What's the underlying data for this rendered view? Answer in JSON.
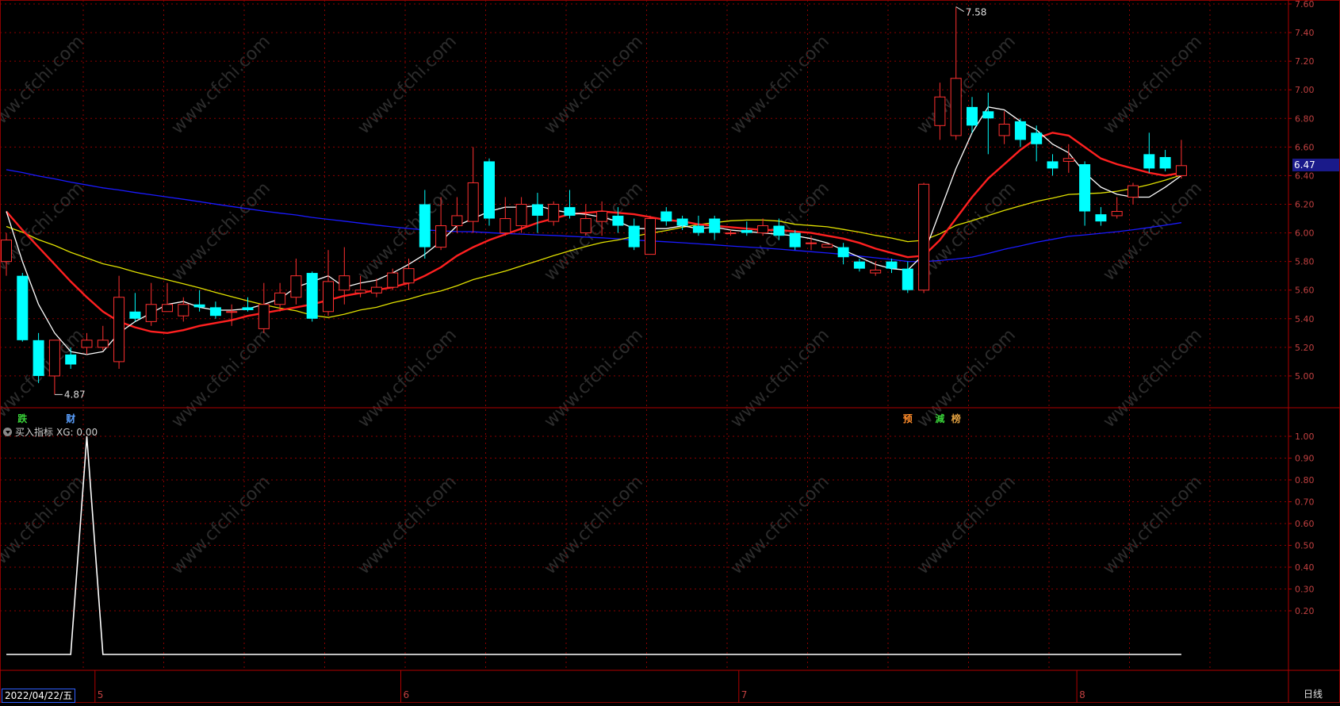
{
  "indicator": {
    "title": "买入指标",
    "value_label": "XG: 0.00"
  },
  "cursor_date": "2022/04/22/五",
  "period_button": "日线",
  "last_price_tag": "6.47",
  "markers": {
    "low_label": "4.87",
    "high_label": "7.58"
  },
  "event_tags": [
    {
      "text": "跌",
      "color": "#39d239",
      "bar": 1
    },
    {
      "text": "财",
      "color": "#5aa0ff",
      "bar": 4
    },
    {
      "text": "预",
      "color": "#ff8c2a",
      "bar": 56
    },
    {
      "text": "減",
      "color": "#39d239",
      "bar": 58
    },
    {
      "text": "榜",
      "color": "#e0a040",
      "bar": 59
    }
  ],
  "watermark": "www.cfchi.com",
  "colors": {
    "up": "#ff3030",
    "down": "#00ffff",
    "ma5": "#ffffff",
    "ma10": "#ff2020",
    "ma20": "#e0e000",
    "ma60": "#1a1aff",
    "grid": "#8b0000"
  },
  "chart_data": [
    {
      "type": "candlestick",
      "ylim": [
        4.8,
        7.6
      ],
      "y_ticks": [
        "7.60",
        "7.40",
        "7.20",
        "7.00",
        "6.80",
        "6.60",
        "6.40",
        "6.20",
        "6.00",
        "5.80",
        "5.60",
        "5.40",
        "5.20",
        "5.00"
      ],
      "x_month_labels": [
        {
          "label": "5",
          "bar": 6
        },
        {
          "label": "6",
          "bar": 25
        },
        {
          "label": "7",
          "bar": 46
        },
        {
          "label": "8",
          "bar": 67
        }
      ],
      "candles": [
        [
          5.8,
          5.95,
          6.0,
          5.7
        ],
        [
          5.7,
          5.25,
          5.72,
          5.24
        ],
        [
          5.25,
          5.0,
          5.3,
          4.95
        ],
        [
          5.0,
          5.25,
          5.25,
          4.87
        ],
        [
          5.15,
          5.08,
          5.2,
          5.05
        ],
        [
          5.2,
          5.25,
          5.3,
          5.15
        ],
        [
          5.2,
          5.25,
          5.35,
          5.18
        ],
        [
          5.1,
          5.55,
          5.7,
          5.05
        ],
        [
          5.45,
          5.4,
          5.58,
          5.38
        ],
        [
          5.38,
          5.5,
          5.65,
          5.35
        ],
        [
          5.45,
          5.5,
          5.65,
          5.45
        ],
        [
          5.42,
          5.5,
          5.55,
          5.38
        ],
        [
          5.5,
          5.48,
          5.6,
          5.45
        ],
        [
          5.48,
          5.42,
          5.52,
          5.4
        ],
        [
          5.45,
          5.45,
          5.5,
          5.35
        ],
        [
          5.48,
          5.46,
          5.55,
          5.45
        ],
        [
          5.33,
          5.5,
          5.65,
          5.3
        ],
        [
          5.5,
          5.58,
          5.65,
          5.45
        ],
        [
          5.55,
          5.7,
          5.82,
          5.5
        ],
        [
          5.72,
          5.4,
          5.73,
          5.38
        ],
        [
          5.45,
          5.66,
          5.88,
          5.42
        ],
        [
          5.6,
          5.7,
          5.9,
          5.5
        ],
        [
          5.58,
          5.6,
          5.7,
          5.55
        ],
        [
          5.58,
          5.62,
          5.68,
          5.55
        ],
        [
          5.62,
          5.72,
          5.75,
          5.6
        ],
        [
          5.65,
          5.75,
          5.82,
          5.6
        ],
        [
          6.2,
          5.9,
          6.3,
          5.82
        ],
        [
          5.9,
          6.05,
          6.25,
          5.88
        ],
        [
          6.05,
          6.12,
          6.25,
          6.0
        ],
        [
          6.08,
          6.35,
          6.6,
          6.0
        ],
        [
          6.5,
          6.1,
          6.52,
          6.05
        ],
        [
          6.0,
          6.1,
          6.25,
          5.98
        ],
        [
          6.05,
          6.2,
          6.25,
          6.0
        ],
        [
          6.2,
          6.12,
          6.28,
          6.0
        ],
        [
          6.08,
          6.2,
          6.22,
          6.05
        ],
        [
          6.18,
          6.12,
          6.3,
          6.1
        ],
        [
          6.0,
          6.1,
          6.2,
          5.98
        ],
        [
          6.08,
          6.15,
          6.22,
          5.98
        ],
        [
          6.12,
          6.05,
          6.18,
          6.0
        ],
        [
          6.05,
          5.9,
          6.1,
          5.88
        ],
        [
          5.85,
          6.1,
          6.12,
          5.85
        ],
        [
          6.15,
          6.08,
          6.18,
          6.05
        ],
        [
          6.1,
          6.05,
          6.12,
          6.02
        ],
        [
          6.05,
          6.0,
          6.12,
          5.98
        ],
        [
          6.1,
          6.0,
          6.12,
          5.95
        ],
        [
          6.0,
          6.0,
          6.02,
          5.98
        ],
        [
          6.02,
          6.0,
          6.08,
          5.98
        ],
        [
          6.0,
          6.05,
          6.1,
          5.98
        ],
        [
          6.05,
          5.98,
          6.1,
          5.95
        ],
        [
          6.0,
          5.9,
          6.02,
          5.88
        ],
        [
          5.93,
          5.93,
          5.98,
          5.88
        ],
        [
          5.9,
          5.92,
          5.92,
          5.9
        ],
        [
          5.9,
          5.83,
          5.93,
          5.78
        ],
        [
          5.8,
          5.75,
          5.82,
          5.73
        ],
        [
          5.72,
          5.74,
          5.8,
          5.7
        ],
        [
          5.8,
          5.75,
          5.82,
          5.72
        ],
        [
          5.75,
          5.6,
          5.8,
          5.58
        ],
        [
          5.6,
          6.34,
          6.35,
          5.58
        ],
        [
          6.75,
          6.95,
          7.05,
          6.65
        ],
        [
          6.68,
          7.08,
          7.58,
          6.65
        ],
        [
          6.88,
          6.75,
          6.95,
          6.7
        ],
        [
          6.85,
          6.8,
          6.98,
          6.55
        ],
        [
          6.68,
          6.76,
          6.85,
          6.62
        ],
        [
          6.78,
          6.65,
          6.8,
          6.6
        ],
        [
          6.7,
          6.62,
          6.75,
          6.5
        ],
        [
          6.5,
          6.45,
          6.55,
          6.4
        ],
        [
          6.5,
          6.52,
          6.62,
          6.42
        ],
        [
          6.48,
          6.15,
          6.5,
          6.05
        ],
        [
          6.13,
          6.08,
          6.18,
          6.05
        ],
        [
          6.12,
          6.15,
          6.25,
          6.1
        ],
        [
          6.25,
          6.33,
          6.35,
          6.2
        ],
        [
          6.55,
          6.45,
          6.7,
          6.42
        ],
        [
          6.53,
          6.45,
          6.58,
          6.43
        ],
        [
          6.4,
          6.47,
          6.65,
          6.38
        ]
      ],
      "ma5": [
        6.15,
        5.8,
        5.5,
        5.3,
        5.17,
        5.15,
        5.17,
        5.3,
        5.38,
        5.44,
        5.5,
        5.52,
        5.48,
        5.46,
        5.46,
        5.47,
        5.5,
        5.54,
        5.62,
        5.66,
        5.7,
        5.62,
        5.65,
        5.67,
        5.72,
        5.78,
        5.85,
        5.94,
        6.05,
        6.1,
        6.15,
        6.18,
        6.18,
        6.19,
        6.16,
        6.14,
        6.13,
        6.11,
        6.08,
        6.03,
        6.03,
        6.03,
        6.05,
        6.03,
        6.04,
        6.02,
        6.01,
        6.0,
        5.99,
        5.98,
        5.96,
        5.93,
        5.88,
        5.83,
        5.78,
        5.75,
        5.74,
        5.85,
        6.15,
        6.45,
        6.7,
        6.88,
        6.86,
        6.78,
        6.72,
        6.62,
        6.56,
        6.42,
        6.32,
        6.27,
        6.25,
        6.25,
        6.32,
        6.4
      ],
      "ma10": [
        6.15,
        6.02,
        5.9,
        5.78,
        5.66,
        5.55,
        5.45,
        5.38,
        5.34,
        5.31,
        5.3,
        5.32,
        5.35,
        5.37,
        5.39,
        5.42,
        5.44,
        5.46,
        5.48,
        5.5,
        5.53,
        5.56,
        5.58,
        5.6,
        5.62,
        5.65,
        5.7,
        5.76,
        5.84,
        5.9,
        5.95,
        5.99,
        6.03,
        6.07,
        6.1,
        6.13,
        6.14,
        6.15,
        6.14,
        6.13,
        6.11,
        6.09,
        6.08,
        6.06,
        6.05,
        6.04,
        6.03,
        6.02,
        6.02,
        6.01,
        6.0,
        5.98,
        5.96,
        5.93,
        5.89,
        5.86,
        5.83,
        5.84,
        5.95,
        6.1,
        6.25,
        6.38,
        6.48,
        6.58,
        6.66,
        6.7,
        6.68,
        6.6,
        6.52,
        6.48,
        6.45,
        6.42,
        6.4,
        6.42
      ]
    },
    {
      "type": "line",
      "name": "XG",
      "ylim": [
        0,
        1.0
      ],
      "y_ticks": [
        "1.00",
        "0.90",
        "0.80",
        "0.70",
        "0.60",
        "0.50",
        "0.40",
        "0.30",
        "0.20"
      ],
      "spike_bar": 5,
      "n_bars": 74
    }
  ]
}
